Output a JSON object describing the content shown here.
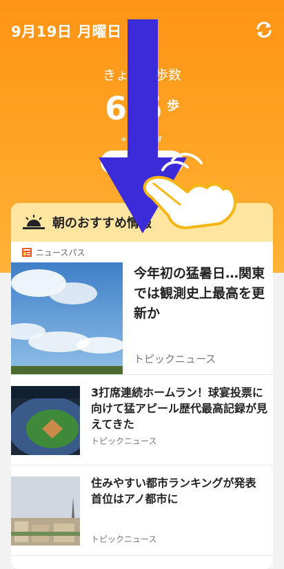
{
  "header": {
    "date": "9月19日 月曜日",
    "steps_label": "きょうの歩数",
    "steps_value": "6  5",
    "steps_unit": "歩",
    "steps_note": "※おお            数です",
    "detail_button": "詳    "
  },
  "card": {
    "title": "朝のおすすめ情報",
    "source": "ニュースパス",
    "articles": [
      {
        "title": "今年初の猛暑日…関東では観測史上最高を更新か",
        "tag": "トピックニュース"
      },
      {
        "title": "3打席連続ホームラン！球宴投票に向けて猛アピール歴代最高記録が見えてきた",
        "tag": "トピックニュース"
      },
      {
        "title": "住みやすい都市ランキングが発表 首位はアノ都市に",
        "tag": "トピックニュース"
      }
    ]
  },
  "icons": {
    "refresh": "refresh-icon",
    "sunrise": "sunrise-icon",
    "newspaper": "newspaper-icon",
    "arrow": "swipe-down-arrow-icon",
    "hand": "pointing-hand-icon"
  },
  "colors": {
    "header_orange": "#ff9416",
    "card_header": "#ffe5a0",
    "arrow": "#3b2bd9"
  }
}
